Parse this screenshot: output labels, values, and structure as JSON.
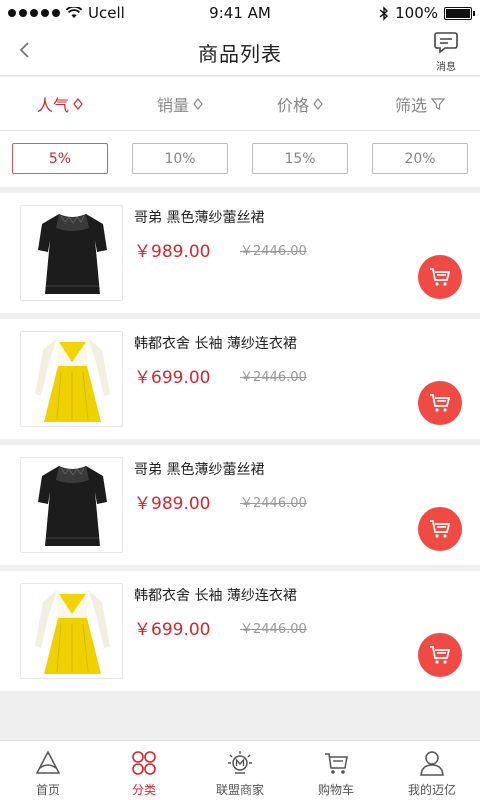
{
  "status": {
    "carrier": "Ucell",
    "time": "9:41 AM",
    "battery": "100%"
  },
  "nav": {
    "title": "商品列表",
    "msg_label": "消息"
  },
  "sort": [
    {
      "label": "人气",
      "active": true
    },
    {
      "label": "销量",
      "active": false
    },
    {
      "label": "价格",
      "active": false
    },
    {
      "label": "筛选",
      "active": false
    }
  ],
  "discounts": [
    {
      "label": "5%",
      "active": true
    },
    {
      "label": "10%",
      "active": false
    },
    {
      "label": "15%",
      "active": false
    },
    {
      "label": "20%",
      "active": false
    }
  ],
  "products": [
    {
      "name": "哥弟 黑色薄纱蕾丝裙",
      "price": "￥989.00",
      "old_price": "￥2446.00",
      "image": "black-dress"
    },
    {
      "name": "韩都衣舍 长袖 薄纱连衣裙",
      "price": "￥699.00",
      "old_price": "￥2446.00",
      "image": "yellow-dress"
    },
    {
      "name": "哥弟 黑色薄纱蕾丝裙",
      "price": "￥989.00",
      "old_price": "￥2446.00",
      "image": "black-dress"
    },
    {
      "name": "韩都衣舍 长袖 薄纱连衣裙",
      "price": "￥699.00",
      "old_price": "￥2446.00",
      "image": "yellow-dress"
    }
  ],
  "tabs": [
    {
      "label": "首页",
      "icon": "home-icon",
      "active": false
    },
    {
      "label": "分类",
      "icon": "category-icon",
      "active": true
    },
    {
      "label": "联盟商家",
      "icon": "merchant-icon",
      "active": false
    },
    {
      "label": "购物车",
      "icon": "cart-icon",
      "active": false
    },
    {
      "label": "我的迈亿",
      "icon": "profile-icon",
      "active": false
    }
  ],
  "colors": {
    "accent": "#d7262d",
    "cart_button": "#ef4a44"
  }
}
